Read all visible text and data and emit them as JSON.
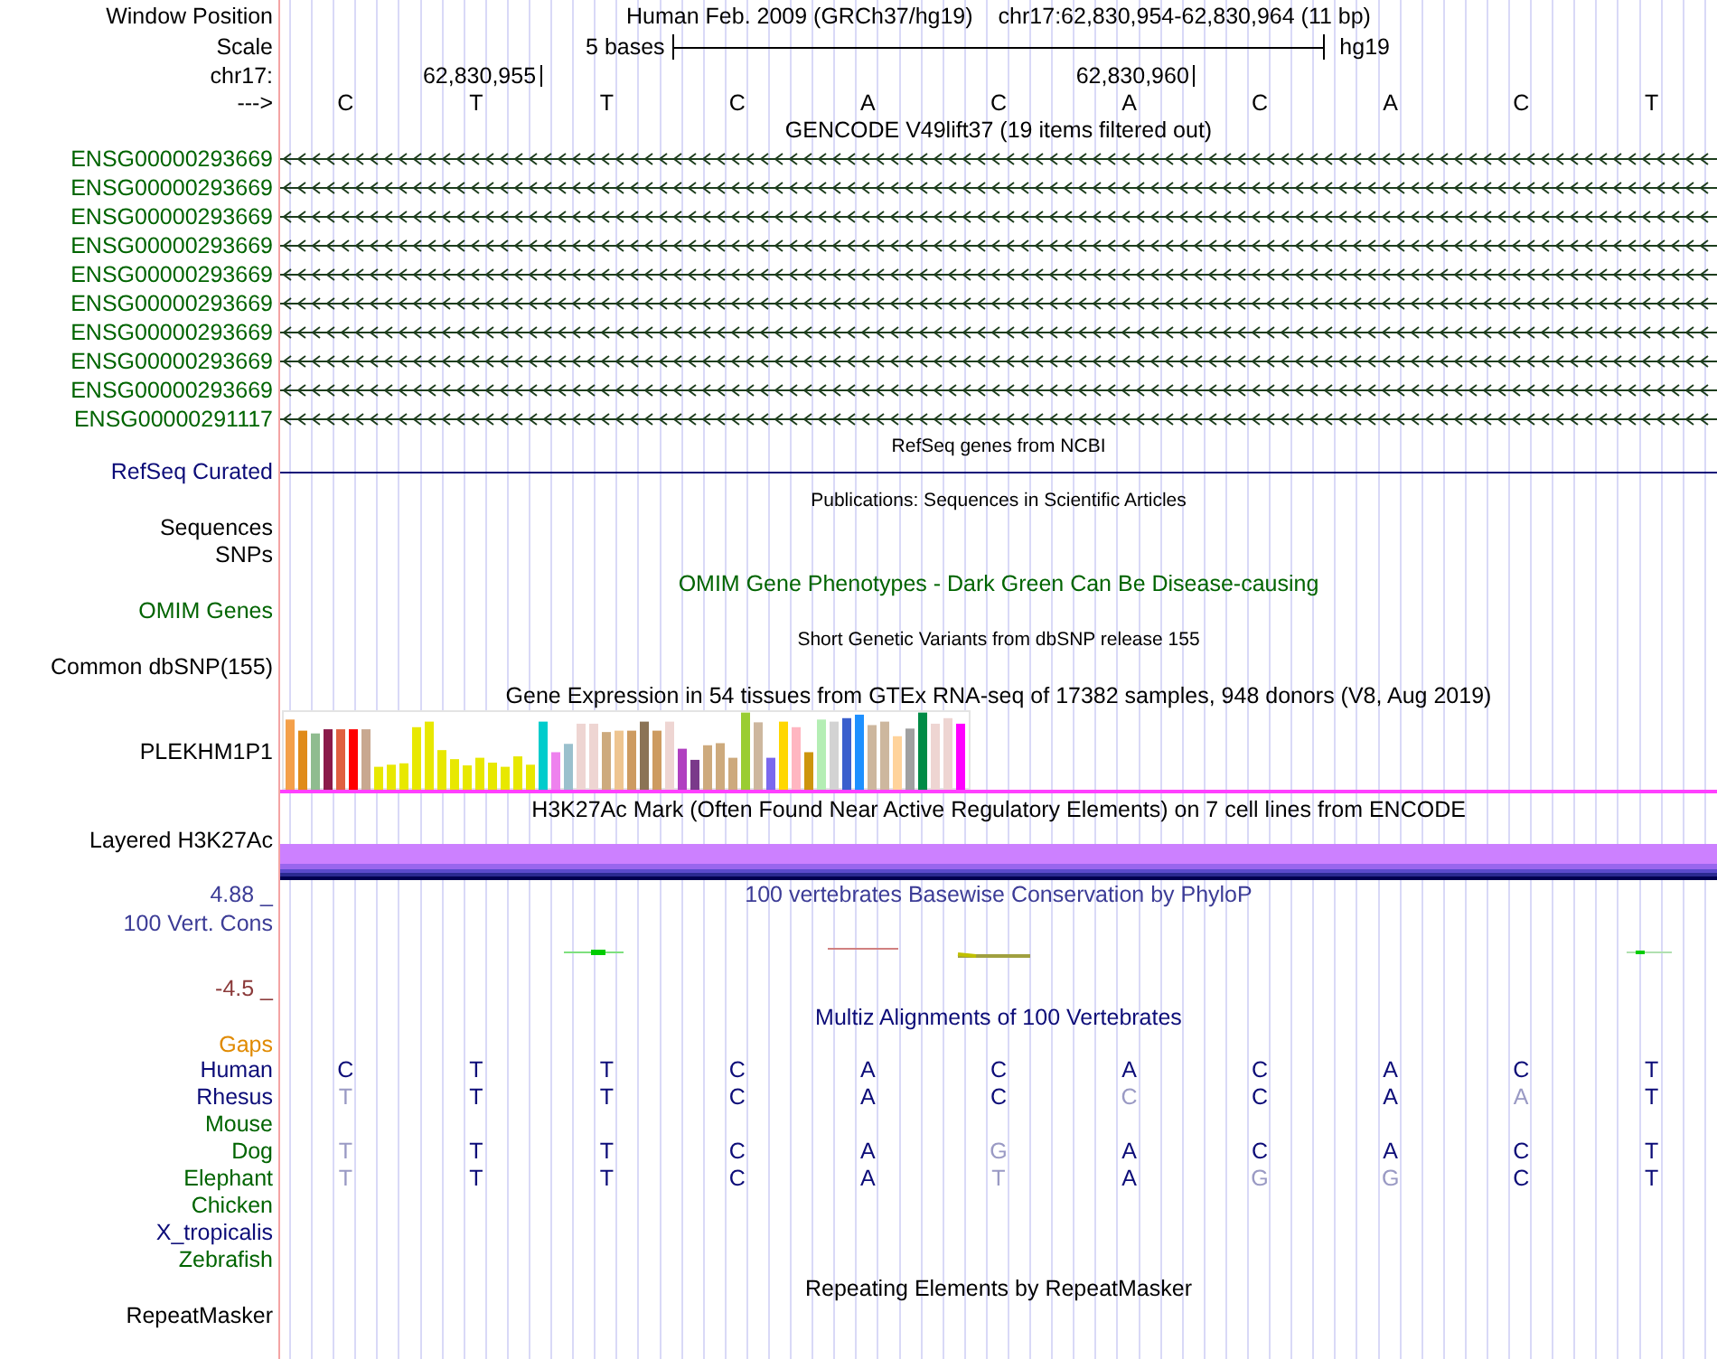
{
  "header": {
    "position_label": "Window Position",
    "assembly": "Human Feb. 2009 (GRCh37/hg19)",
    "range": "chr17:62,830,954-62,830,964 (11 bp)",
    "scale_label": "Scale",
    "scale_text": "5 bases",
    "scale_db": "hg19",
    "ruler_label": "chr17:",
    "strand_label": "--->"
  },
  "bases": [
    {
      "base": "C"
    },
    {
      "base": "T",
      "ruler": "62,830,955"
    },
    {
      "base": "T"
    },
    {
      "base": "C"
    },
    {
      "base": "A"
    },
    {
      "base": "C"
    },
    {
      "base": "A",
      "ruler": "62,830,960"
    },
    {
      "base": "C"
    },
    {
      "base": "A"
    },
    {
      "base": "C"
    },
    {
      "base": "T"
    }
  ],
  "tracks": [
    {
      "kind": "gencode",
      "title": "GENCODE V49lift37 (19 items filtered out)",
      "items": [
        {
          "name": "ENSG00000293669",
          "color": "#006400"
        },
        {
          "name": "ENSG00000293669",
          "color": "#006400"
        },
        {
          "name": "ENSG00000293669",
          "color": "#006400"
        },
        {
          "name": "ENSG00000293669",
          "color": "#006400"
        },
        {
          "name": "ENSG00000293669",
          "color": "#006400"
        },
        {
          "name": "ENSG00000293669",
          "color": "#006400"
        },
        {
          "name": "ENSG00000293669",
          "color": "#006400"
        },
        {
          "name": "ENSG00000293669",
          "color": "#006400"
        },
        {
          "name": "ENSG00000293669",
          "color": "#006400"
        },
        {
          "name": "ENSG00000291117",
          "color": "#006400"
        }
      ]
    },
    {
      "kind": "refseq",
      "title": "RefSeq genes from NCBI",
      "labels": [
        {
          "text": "RefSeq Curated",
          "color": "#0c0c78"
        }
      ]
    },
    {
      "kind": "publications",
      "title": "Publications: Sequences in Scientific Articles",
      "labels": [
        {
          "text": "Sequences",
          "color": "#000000"
        },
        {
          "text": "SNPs",
          "color": "#000000"
        }
      ]
    },
    {
      "kind": "omim",
      "title": "OMIM Gene Phenotypes - Dark Green Can Be Disease-causing",
      "color": "#006400",
      "labels": [
        {
          "text": "OMIM Genes",
          "color": "#006400"
        }
      ]
    },
    {
      "kind": "dbsnp",
      "title": "Short Genetic Variants from dbSNP release 155",
      "labels": [
        {
          "text": "Common dbSNP(155)",
          "color": "#000000"
        }
      ]
    },
    {
      "kind": "gtex",
      "title": "Gene Expression in 54 tissues from GTEx RNA-seq of 17382 samples, 948 donors (V8, Aug 2019)",
      "labels": [
        {
          "text": "PLEKHM1P1",
          "color": "#000000"
        }
      ]
    },
    {
      "kind": "h3k27ac",
      "title": "H3K27Ac Mark (Often Found Near Active Regulatory Elements) on 7 cell lines from ENCODE",
      "labels": [
        {
          "text": "Layered H3K27Ac",
          "color": "#000000"
        }
      ]
    },
    {
      "kind": "phylop",
      "title": "100 vertebrates Basewise Conservation by PhyloP",
      "color": "#3c3c96",
      "max": "4.88 _",
      "min": "-4.5 _",
      "labels": [
        {
          "text": "100 Vert. Cons",
          "color": "#3c3c96"
        }
      ]
    },
    {
      "kind": "multiz",
      "title": "Multiz Alignments of 100 Vertebrates",
      "color": "#0c0c78",
      "gaps": {
        "text": "Gaps",
        "color": "#e08a00"
      },
      "species": [
        {
          "name": "Human",
          "color": "#0c0c78",
          "bases": [
            {
              "base": "C",
              "match": true
            },
            {
              "base": "T",
              "match": true
            },
            {
              "base": "T",
              "match": true
            },
            {
              "base": "C",
              "match": true
            },
            {
              "base": "A",
              "match": true
            },
            {
              "base": "C",
              "match": true
            },
            {
              "base": "A",
              "match": true
            },
            {
              "base": "C",
              "match": true
            },
            {
              "base": "A",
              "match": true
            },
            {
              "base": "C",
              "match": true
            },
            {
              "base": "T",
              "match": true
            }
          ]
        },
        {
          "name": "Rhesus",
          "color": "#0c0c78",
          "bases": [
            {
              "base": "T",
              "match": false
            },
            {
              "base": "T",
              "match": true
            },
            {
              "base": "T",
              "match": true
            },
            {
              "base": "C",
              "match": true
            },
            {
              "base": "A",
              "match": true
            },
            {
              "base": "C",
              "match": true
            },
            {
              "base": "C",
              "match": false
            },
            {
              "base": "C",
              "match": true
            },
            {
              "base": "A",
              "match": true
            },
            {
              "base": "A",
              "match": false
            },
            {
              "base": "T",
              "match": true
            }
          ]
        },
        {
          "name": "Mouse",
          "color": "#006400"
        },
        {
          "name": "Dog",
          "color": "#006400",
          "bases": [
            {
              "base": "T",
              "match": false
            },
            {
              "base": "T",
              "match": true
            },
            {
              "base": "T",
              "match": true
            },
            {
              "base": "C",
              "match": true
            },
            {
              "base": "A",
              "match": true
            },
            {
              "base": "G",
              "match": false
            },
            {
              "base": "A",
              "match": true
            },
            {
              "base": "C",
              "match": true
            },
            {
              "base": "A",
              "match": true
            },
            {
              "base": "C",
              "match": true
            },
            {
              "base": "T",
              "match": true
            }
          ]
        },
        {
          "name": "Elephant",
          "color": "#006400",
          "bases": [
            {
              "base": "T",
              "match": false
            },
            {
              "base": "T",
              "match": true
            },
            {
              "base": "T",
              "match": true
            },
            {
              "base": "C",
              "match": true
            },
            {
              "base": "A",
              "match": true
            },
            {
              "base": "T",
              "match": false
            },
            {
              "base": "A",
              "match": true
            },
            {
              "base": "G",
              "match": false
            },
            {
              "base": "G",
              "match": false
            },
            {
              "base": "C",
              "match": true
            },
            {
              "base": "T",
              "match": true
            }
          ]
        },
        {
          "name": "Chicken",
          "color": "#006400"
        },
        {
          "name": "X_tropicalis",
          "color": "#0c0c78"
        },
        {
          "name": "Zebrafish",
          "color": "#006400"
        }
      ]
    },
    {
      "kind": "repeatmasker",
      "title": "Repeating Elements by RepeatMasker",
      "labels": [
        {
          "text": "RepeatMasker",
          "color": "#000000"
        }
      ]
    }
  ]
}
